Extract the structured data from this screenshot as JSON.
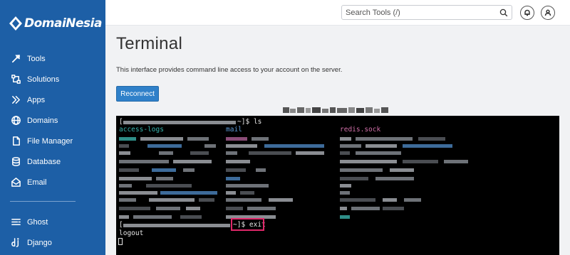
{
  "brand": {
    "name": "DomaiNesia"
  },
  "sidebar": {
    "items": [
      {
        "label": "Tools",
        "icon": "tools-icon"
      },
      {
        "label": "Solutions",
        "icon": "solutions-icon"
      },
      {
        "label": "Apps",
        "icon": "apps-icon"
      },
      {
        "label": "Domains",
        "icon": "globe-icon"
      },
      {
        "label": "File Manager",
        "icon": "file-icon"
      },
      {
        "label": "Database",
        "icon": "database-icon"
      },
      {
        "label": "Email",
        "icon": "email-icon"
      }
    ],
    "apps": [
      {
        "label": "Ghost",
        "icon": "ghost-icon"
      },
      {
        "label": "Django",
        "icon": "django-icon"
      }
    ]
  },
  "topbar": {
    "search_placeholder": "Search Tools (/)",
    "search_value": ""
  },
  "main": {
    "title": "Terminal",
    "description": "This interface provides command line access to your account on the server.",
    "reconnect_label": "Reconnect"
  },
  "terminal": {
    "prompt1_suffix": "~]$ ls",
    "prompt1_open": "[",
    "dir1": "access-logs",
    "dir2": "mail",
    "file1": "redis.sock",
    "prompt2_open": "[",
    "prompt2_suffix": "~]$ exit",
    "output": "logout"
  },
  "colors": {
    "sidebar": "#1d5fa6",
    "accent_button": "#2f80c9",
    "terminal_bg": "#000000",
    "highlight_box": "#e0286a",
    "dir_color": "#38b6b0",
    "mail_color": "#5f9bd8",
    "sock_color": "#d06fa8"
  }
}
